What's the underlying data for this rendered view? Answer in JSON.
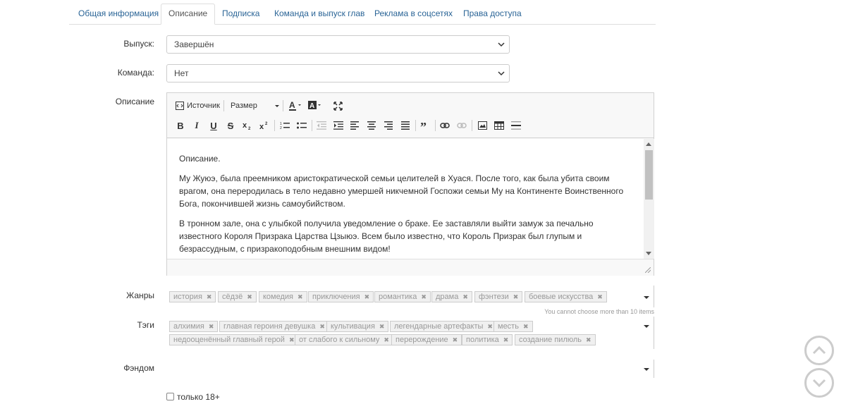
{
  "tabs": [
    {
      "label": "Общая информация"
    },
    {
      "label": "Описание"
    },
    {
      "label": "Подписка"
    },
    {
      "label": "Команда и выпуск глав"
    },
    {
      "label": "Реклама в соцсетях"
    },
    {
      "label": "Права доступа"
    }
  ],
  "active_tab": "Описание",
  "release": {
    "label": "Выпуск:",
    "value": "Завершён"
  },
  "team": {
    "label": "Команда:",
    "value": "Нет"
  },
  "description": {
    "label": "Описание",
    "toolbar": {
      "source": "Источник",
      "size": "Размер"
    },
    "paragraphs": [
      "Описание.",
      "Му Жуюэ, была преемником аристократической семьи целителей в Хуася. После того, как была убита своим врагом, она переродилась в тело недавно умершей никчемной Госпожи семьи Му на Континенте Воинственного Бога, покончившей жизнь самоубийством.",
      "В тронном зале, она с улыбкой получила уведомление о браке. Ее заставляли выйти замуж за печально известного Короля Призрака Царства Цзыюэ. Всем было известно, что Король Призрак был глупым и безрассудным, с призракоподобным внешним видом!"
    ]
  },
  "genres": {
    "label": "Жанры",
    "items": [
      "история",
      "сёдзё",
      "комедия",
      "приключения",
      "романтика",
      "драма",
      "фэнтези",
      "боевые искусства"
    ],
    "limit_note": "You cannot choose more than 10 items"
  },
  "tags": {
    "label": "Тэги",
    "items": [
      "алхимия",
      "главная героиня девушка",
      "культивация",
      "легендарные артефакты",
      "месть",
      "недооценённый главный герой",
      "от слабого к сильному",
      "перерождение",
      "политика",
      "создание пилюль"
    ]
  },
  "fandom": {
    "label": "Фэндом"
  },
  "adult": {
    "label": "только 18+",
    "checked": false
  },
  "colors": {
    "link": "#2a6496",
    "tag_bg": "#f0f0f0",
    "scroll_btn": "#cccccc"
  }
}
